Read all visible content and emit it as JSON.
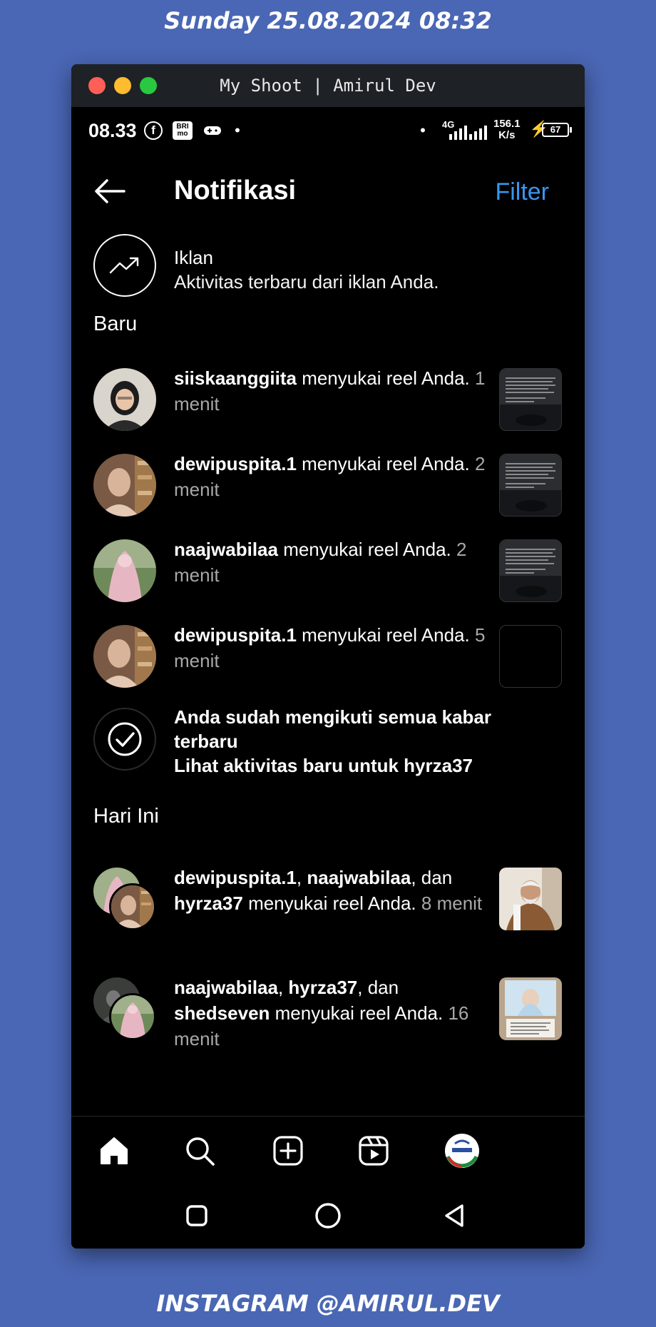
{
  "captions": {
    "top": "Sunday 25.08.2024 08:32",
    "bottom": "INSTAGRAM @AMIRUL.DEV"
  },
  "window": {
    "title": "My Shoot | Amirul Dev"
  },
  "status_bar": {
    "time": "08.33",
    "bri_top": "BRI",
    "bri_bottom": "mo",
    "network": "4G",
    "speed_value": "156.1",
    "speed_unit": "K/s",
    "battery": "67"
  },
  "header": {
    "title": "Notifikasi",
    "filter_label": "Filter"
  },
  "ads": {
    "title": "Iklan",
    "subtitle": "Aktivitas terbaru dari iklan Anda."
  },
  "sections": {
    "new": "Baru",
    "today": "Hari Ini"
  },
  "new_notifications": [
    {
      "user": "siiskaanggiita",
      "action": " menyukai reel Anda. ",
      "time": "1 menit",
      "thumb": "dark-video"
    },
    {
      "user": "dewipuspita.1",
      "action": " menyukai reel Anda. ",
      "time": "2 menit",
      "thumb": "dark-video"
    },
    {
      "user": "naajwabilaa",
      "action": " menyukai reel Anda. ",
      "time": "2 menit",
      "thumb": "dark-video"
    },
    {
      "user": "dewipuspita.1",
      "action": " menyukai reel Anda. ",
      "time": "5 menit",
      "thumb": "black"
    }
  ],
  "caught_up": {
    "line1": "Anda sudah mengikuti semua kabar terbaru",
    "line2": "Lihat aktivitas baru untuk hyrza37"
  },
  "today_notifications": [
    {
      "user1": "dewipuspita.1",
      "sep1": ", ",
      "user2": "naajwabilaa",
      "sep2": ", dan ",
      "user3": "hyrza37",
      "action": " menyukai reel Anda. ",
      "time": "8 menit"
    },
    {
      "user1": "naajwabilaa",
      "sep1": ", ",
      "user2": "hyrza37",
      "sep2": ", dan ",
      "user3": "shedseven",
      "action": " menyukai reel Anda. ",
      "time": "16 menit"
    }
  ],
  "colors": {
    "accent": "#3897f0",
    "background": "#4a67b5",
    "muted": "#a8a8a8"
  },
  "bottom_nav": [
    "home-icon",
    "search-icon",
    "create-icon",
    "reels-icon",
    "profile-avatar"
  ],
  "system_nav": [
    "recents-button",
    "home-button",
    "back-button"
  ]
}
